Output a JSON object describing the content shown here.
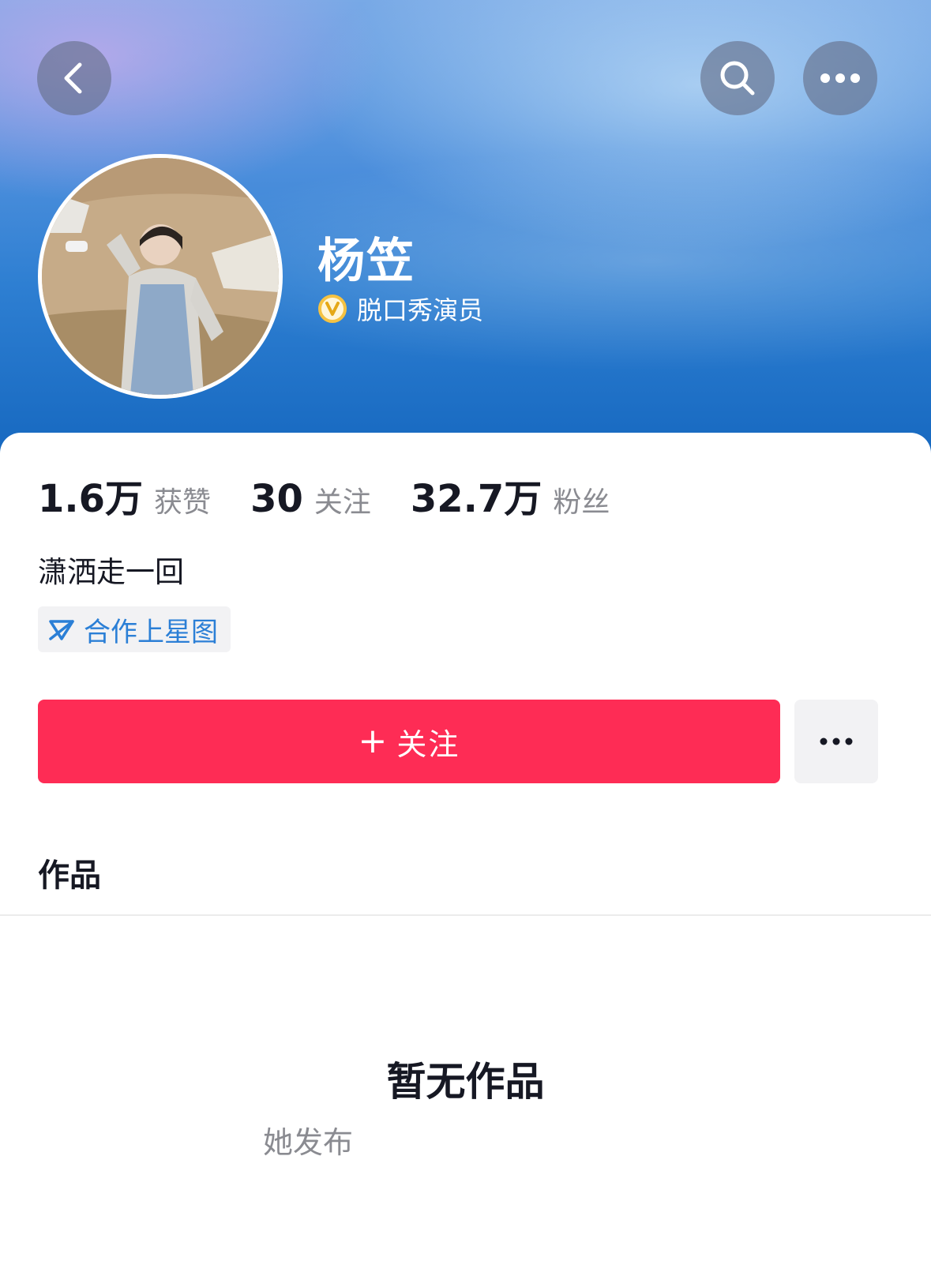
{
  "profile": {
    "name": "杨笠",
    "verification": "脱口秀演员",
    "bio": "潇洒走一回",
    "tag": "合作上星图"
  },
  "stats": [
    {
      "value": "1.6万",
      "label": "获赞"
    },
    {
      "value": "30",
      "label": "关注"
    },
    {
      "value": "32.7万",
      "label": "粉丝"
    }
  ],
  "actions": {
    "follow_plus": "+",
    "follow_label": "关注"
  },
  "tabs": {
    "works": "作品"
  },
  "empty": {
    "title": "暂无作品",
    "subtitle": "她发布"
  },
  "colors": {
    "follow": "#fe2c55",
    "tag_text": "#2b7fd6",
    "verify_badge": "#f5c242"
  },
  "icons": [
    "back-icon",
    "search-icon",
    "more-icon",
    "verified-icon",
    "xingtu-icon"
  ]
}
